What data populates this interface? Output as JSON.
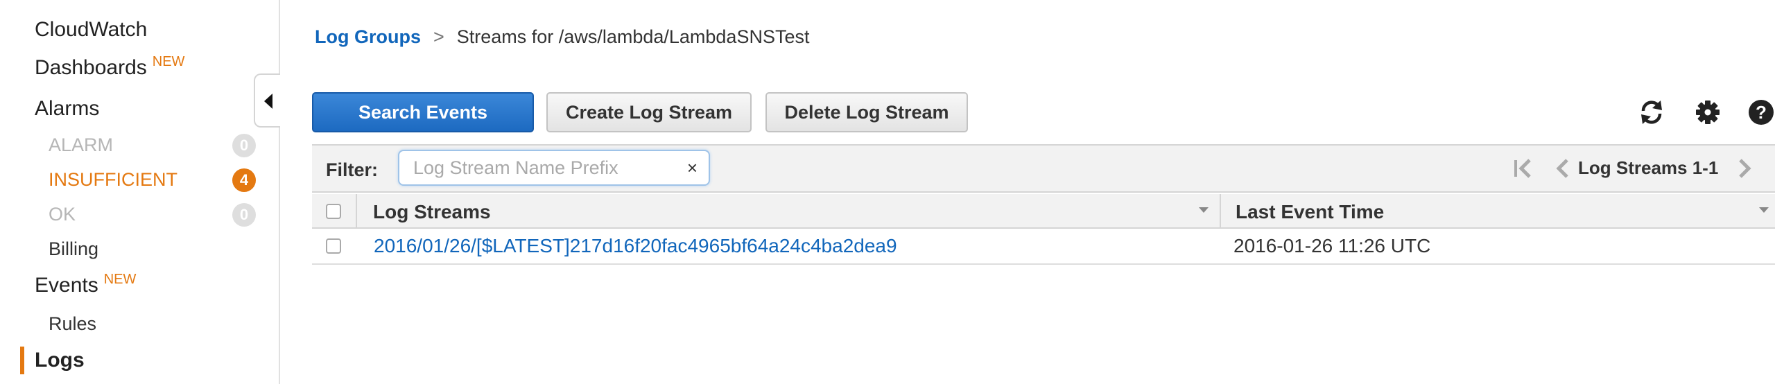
{
  "sidebar": {
    "items": [
      {
        "label": "CloudWatch"
      },
      {
        "label": "Dashboards",
        "badge": "NEW"
      },
      {
        "label": "Alarms"
      },
      {
        "label": "ALARM",
        "count": "0"
      },
      {
        "label": "INSUFFICIENT",
        "count": "4"
      },
      {
        "label": "OK",
        "count": "0"
      },
      {
        "label": "Billing"
      },
      {
        "label": "Events",
        "badge": "NEW"
      },
      {
        "label": "Rules"
      },
      {
        "label": "Logs",
        "active": true
      }
    ]
  },
  "breadcrumb": {
    "link": "Log Groups",
    "separator": ">",
    "current": "Streams for /aws/lambda/LambdaSNSTest"
  },
  "toolbar": {
    "search_label": "Search Events",
    "create_label": "Create Log Stream",
    "delete_label": "Delete Log Stream",
    "icons": [
      "refresh-icon",
      "gear-icon",
      "help-icon"
    ]
  },
  "filter": {
    "label": "Filter:",
    "placeholder": "Log Stream Name Prefix",
    "value": "",
    "clear": "×"
  },
  "pager": {
    "label": "Log Streams 1-1"
  },
  "table": {
    "columns": [
      "Log Streams",
      "Last Event Time"
    ],
    "rows": [
      {
        "stream": "2016/01/26/[$LATEST]217d16f20fac4965bf64a24c4ba2dea9",
        "time": "2016-01-26 11:26 UTC"
      }
    ]
  },
  "colors": {
    "accent": "#e47911",
    "link": "#1166bb",
    "primary_button": "#1d6ac1"
  }
}
